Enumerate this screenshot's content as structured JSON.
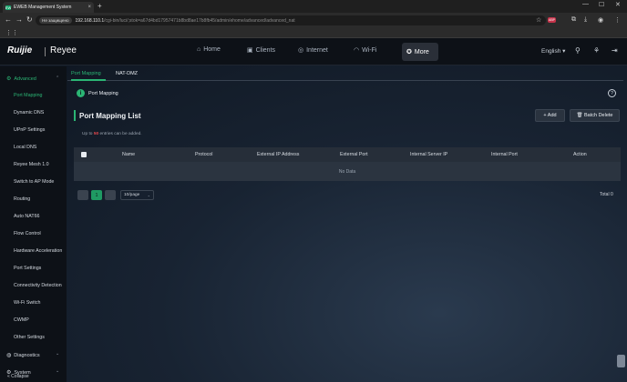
{
  "browser": {
    "tab_title": "EWEB Management System",
    "favicon_text": "EW",
    "tab_close": "×",
    "new_tab": "+",
    "security_label": "Не защищено",
    "url_host": "192.168.110.1",
    "url_path": "/cgi-bin/luci/;stok=a67d4bd17957471b8bd8ae17b8fb45/admin/ehome/advanced/advanced_nat",
    "back": "←",
    "forward": "→",
    "reload": "↻",
    "apps": "⋮⋮",
    "minimize": "—",
    "maximize": "☐",
    "close": "✕",
    "ext_badge": "ABP",
    "star": "☆",
    "menu": "⋮"
  },
  "header": {
    "logo": "Ruijie",
    "logo_brand": "Reyee",
    "nav": [
      {
        "label": "Home",
        "icon": "⌂"
      },
      {
        "label": "Clients",
        "icon": "▣"
      },
      {
        "label": "Internet",
        "icon": "◎"
      },
      {
        "label": "Wi-Fi",
        "icon": "◠"
      },
      {
        "label": "More",
        "icon": "✪"
      }
    ],
    "language": "English",
    "lang_caret": "▾",
    "network_icon": "⚲",
    "plugin_icon": "⚘",
    "logout_icon": "⇥"
  },
  "sidebar": {
    "advanced": "Advanced",
    "items": [
      "Port Mapping",
      "Dynamic DNS",
      "UPnP Settings",
      "Local DNS",
      "Reyee Mesh 1.0",
      "Switch to AP Mode",
      "Routing",
      "Auto NAT66",
      "Flow Control",
      "Hardware Acceleration",
      "Port Settings",
      "Connectivity Detection",
      "Wi-Fi Switch",
      "CWMP",
      "Other Settings"
    ],
    "diagnostics": "Diagnostics",
    "system": "System",
    "collapse": "Collapse",
    "chevron_up": "⌃",
    "chevron_down": "⌄"
  },
  "subtabs": [
    "Port Mapping",
    "NAT-DMZ"
  ],
  "section": {
    "icon_text": "i",
    "title": "Port Mapping",
    "help": "?"
  },
  "list": {
    "title": "Port Mapping List",
    "add_label": "+ Add",
    "batch_delete_label": "🗑 Batch Delete",
    "limit_prefix": "Up to",
    "limit_value": "50",
    "limit_suffix": "entries can be added."
  },
  "table": {
    "columns": [
      "Name",
      "Protocol",
      "External IP Address",
      "External Port",
      "Internal Server IP",
      "Internal Port",
      "Action"
    ],
    "empty": "No Data"
  },
  "pager": {
    "current_page": "1",
    "page_size": "10/page",
    "dropdown": "⌄",
    "total": "Total 0"
  }
}
